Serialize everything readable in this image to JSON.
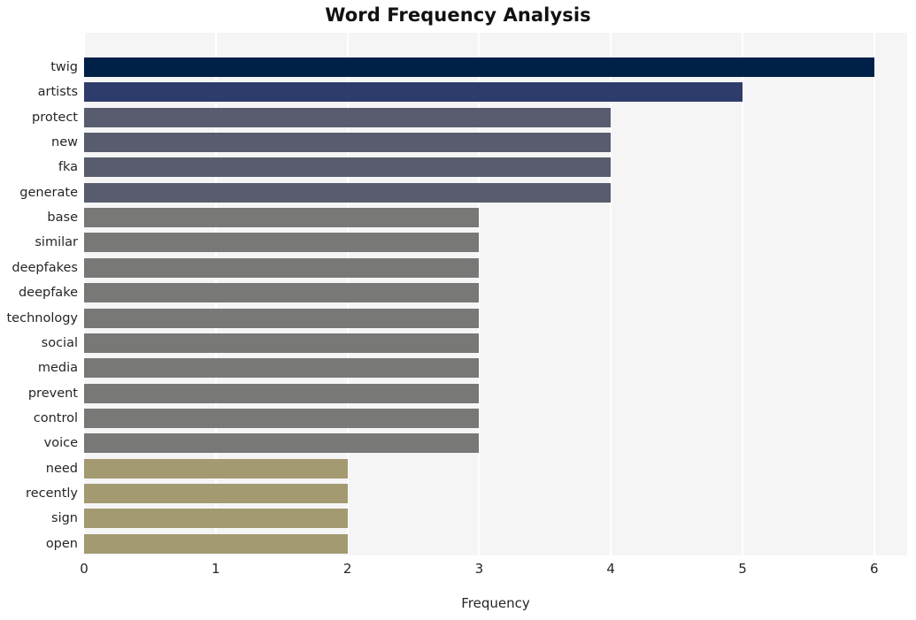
{
  "chart_data": {
    "type": "bar",
    "orientation": "horizontal",
    "title": "Word Frequency Analysis",
    "xlabel": "Frequency",
    "ylabel": "",
    "xlim": [
      0,
      6.25
    ],
    "xticks": [
      0,
      1,
      2,
      3,
      4,
      5,
      6
    ],
    "xtick_labels": [
      "0",
      "1",
      "2",
      "3",
      "4",
      "5",
      "6"
    ],
    "grid": true,
    "grid_axis": "x",
    "grid_color": "#ffffff",
    "plot_background": "#f5f5f5",
    "figure_background": "#ffffff",
    "legend": null,
    "categories": [
      "twig",
      "artists",
      "protect",
      "new",
      "fka",
      "generate",
      "base",
      "similar",
      "deepfakes",
      "deepfake",
      "technology",
      "social",
      "media",
      "prevent",
      "control",
      "voice",
      "need",
      "recently",
      "sign",
      "open"
    ],
    "values": [
      6,
      5,
      4,
      4,
      4,
      4,
      3,
      3,
      3,
      3,
      3,
      3,
      3,
      3,
      3,
      3,
      2,
      2,
      2,
      2
    ],
    "bar_colors": [
      "#002147",
      "#2d3c6b",
      "#585c6e",
      "#585c6e",
      "#585c6e",
      "#585c6e",
      "#787876",
      "#787876",
      "#787876",
      "#787876",
      "#787876",
      "#787876",
      "#787876",
      "#787876",
      "#787876",
      "#787876",
      "#a39a72",
      "#a39a72",
      "#a39a72",
      "#a39a72"
    ],
    "bars": [
      {
        "label": "twig",
        "value": 6,
        "color": "#002147"
      },
      {
        "label": "artists",
        "value": 5,
        "color": "#2d3c6b"
      },
      {
        "label": "protect",
        "value": 4,
        "color": "#585c6e"
      },
      {
        "label": "new",
        "value": 4,
        "color": "#585c6e"
      },
      {
        "label": "fka",
        "value": 4,
        "color": "#585c6e"
      },
      {
        "label": "generate",
        "value": 4,
        "color": "#585c6e"
      },
      {
        "label": "base",
        "value": 3,
        "color": "#787876"
      },
      {
        "label": "similar",
        "value": 3,
        "color": "#787876"
      },
      {
        "label": "deepfakes",
        "value": 3,
        "color": "#787876"
      },
      {
        "label": "deepfake",
        "value": 3,
        "color": "#787876"
      },
      {
        "label": "technology",
        "value": 3,
        "color": "#787876"
      },
      {
        "label": "social",
        "value": 3,
        "color": "#787876"
      },
      {
        "label": "media",
        "value": 3,
        "color": "#787876"
      },
      {
        "label": "prevent",
        "value": 3,
        "color": "#787876"
      },
      {
        "label": "control",
        "value": 3,
        "color": "#787876"
      },
      {
        "label": "voice",
        "value": 3,
        "color": "#787876"
      },
      {
        "label": "need",
        "value": 2,
        "color": "#a39a72"
      },
      {
        "label": "recently",
        "value": 2,
        "color": "#a39a72"
      },
      {
        "label": "sign",
        "value": 2,
        "color": "#a39a72"
      },
      {
        "label": "open",
        "value": 2,
        "color": "#a39a72"
      }
    ]
  }
}
